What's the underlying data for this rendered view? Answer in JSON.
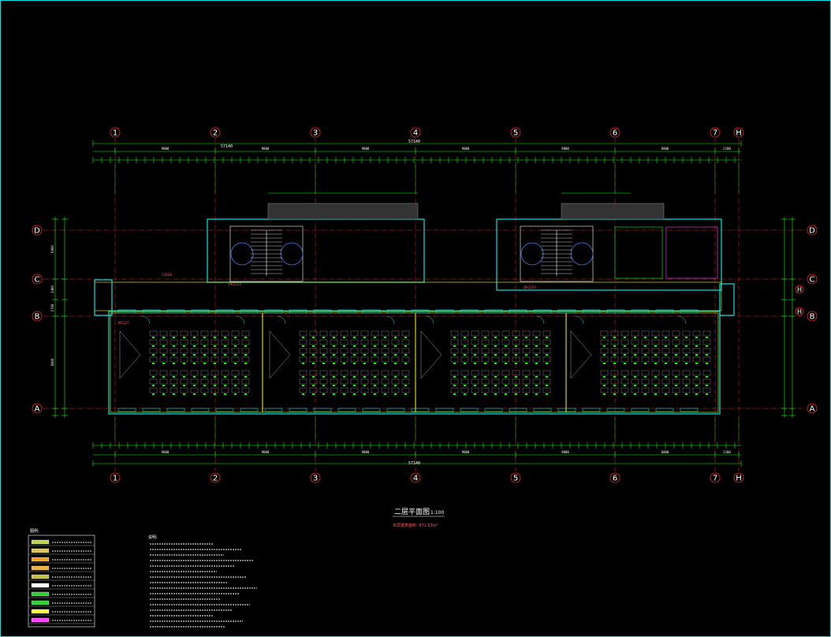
{
  "drawing": {
    "title": "二层平面图",
    "scale": "1:100",
    "area_note": "本层建筑面积: 871.53m²"
  },
  "axes_x": [
    {
      "label": "1"
    },
    {
      "label": "2"
    },
    {
      "label": "3"
    },
    {
      "label": "4"
    },
    {
      "label": "5"
    },
    {
      "label": "6"
    },
    {
      "label": "7"
    },
    {
      "label": "H"
    }
  ],
  "axes_y": [
    {
      "label": "D"
    },
    {
      "label": "C"
    },
    {
      "label": "B"
    },
    {
      "label": "A"
    }
  ],
  "dims_top": {
    "total": "57140",
    "bays": [
      "9000",
      "9000",
      "9000",
      "9000",
      "9000",
      "6800",
      "2100"
    ]
  },
  "dims_bottom": {
    "total": "57140",
    "bays": [
      "9000",
      "9000",
      "9000",
      "9000",
      "9000",
      "6800",
      "2100"
    ]
  },
  "dims_left": [
    "6900",
    "2400",
    "1700",
    "8400"
  ],
  "room_labels": {
    "door_dk1": "DK2223",
    "door_dk2": "DK2223",
    "window_c": "C2628",
    "door_m": "M1227"
  },
  "legend": {
    "title": "图例:",
    "items": [
      {
        "color": "#b8d84a"
      },
      {
        "color": "#d9c35a"
      },
      {
        "color": "#f0a020"
      },
      {
        "color": "#e8b040"
      },
      {
        "color": "#c8c040"
      },
      {
        "color": "#ffffff"
      },
      {
        "color": "#30d030"
      },
      {
        "color": "#30d030"
      },
      {
        "color": "#ffff40"
      },
      {
        "color": "#ff40ff"
      }
    ]
  },
  "notes": {
    "title": "说明:"
  },
  "colors": {
    "grid": "#ff2020",
    "dims": "#00ff00",
    "walls": "#ffff00",
    "accent": "#00e5e5",
    "magenta": "#ff40ff"
  }
}
